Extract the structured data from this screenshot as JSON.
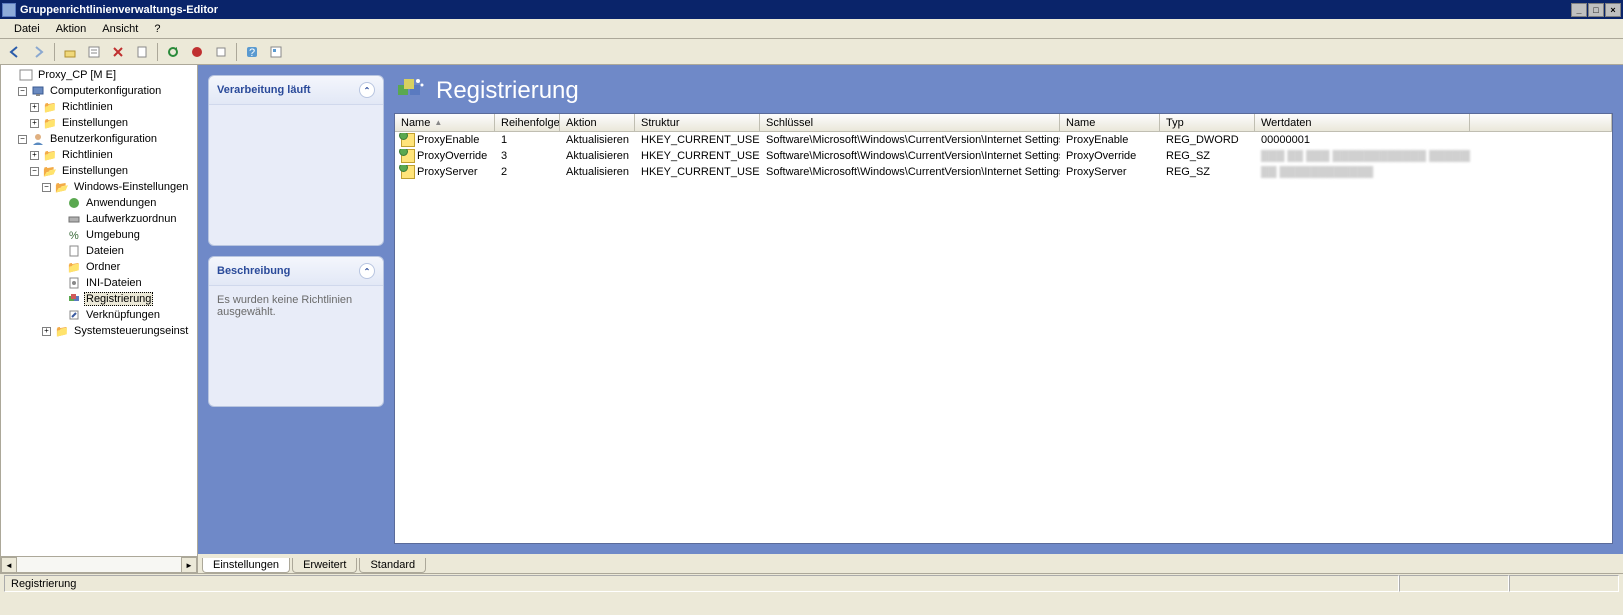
{
  "window": {
    "title": "Gruppenrichtlinienverwaltungs-Editor"
  },
  "menu": {
    "file": "Datei",
    "action": "Aktion",
    "view": "Ansicht",
    "help": "?"
  },
  "tree": {
    "root": "Proxy_CP [M                      E]",
    "comp": "Computerkonfiguration",
    "comp_pol": "Richtlinien",
    "comp_set": "Einstellungen",
    "user": "Benutzerkonfiguration",
    "user_pol": "Richtlinien",
    "user_set": "Einstellungen",
    "win_set": "Windows-Einstellungen",
    "apps": "Anwendungen",
    "drive": "Laufwerkzuordnun",
    "env": "Umgebung",
    "files": "Dateien",
    "folders": "Ordner",
    "ini": "INI-Dateien",
    "reg": "Registrierung",
    "short": "Verknüpfungen",
    "sysctrl": "Systemsteuerungseinst"
  },
  "pane": {
    "title": "Registrierung",
    "processing": "Verarbeitung läuft",
    "desc_head": "Beschreibung",
    "desc_body": "Es wurden keine Richtlinien ausgewählt."
  },
  "table": {
    "cols": {
      "name": "Name",
      "order": "Reihenfolge",
      "action": "Aktion",
      "hive": "Struktur",
      "key": "Schlüssel",
      "vname": "Name",
      "type": "Typ",
      "data": "Wertdaten"
    },
    "rows": [
      {
        "name": "ProxyEnable",
        "order": "1",
        "action": "Aktualisieren",
        "hive": "HKEY_CURRENT_USER",
        "key": "Software\\Microsoft\\Windows\\CurrentVersion\\Internet Settings",
        "vname": "ProxyEnable",
        "type": "REG_DWORD",
        "data": "00000001",
        "blur": false
      },
      {
        "name": "ProxyOverride",
        "order": "3",
        "action": "Aktualisieren",
        "hive": "HKEY_CURRENT_USER",
        "key": "Software\\Microsoft\\Windows\\CurrentVersion\\Internet Settings",
        "vname": "ProxyOverride",
        "type": "REG_SZ",
        "data": "███ ██ ███ ████████████ ██████████ .",
        "blur": true
      },
      {
        "name": "ProxyServer",
        "order": "2",
        "action": "Aktualisieren",
        "hive": "HKEY_CURRENT_USER",
        "key": "Software\\Microsoft\\Windows\\CurrentVersion\\Internet Settings",
        "vname": "ProxyServer",
        "type": "REG_SZ",
        "data": "██ ████████████",
        "blur": true
      }
    ]
  },
  "tabs": {
    "settings": "Einstellungen",
    "ext": "Erweitert",
    "std": "Standard"
  },
  "status": {
    "text": "Registrierung"
  }
}
